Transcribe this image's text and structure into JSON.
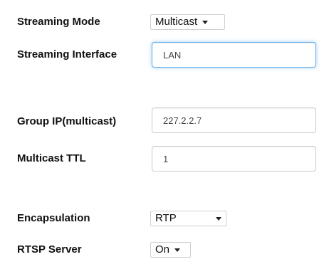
{
  "rows": {
    "streaming_mode": {
      "label": "Streaming Mode",
      "value": "Multicast"
    },
    "streaming_interface": {
      "label": "Streaming Interface",
      "value": "LAN"
    },
    "group_ip": {
      "label": "Group IP(multicast)",
      "value": "227.2.2.7"
    },
    "multicast_ttl": {
      "label": "Multicast TTL",
      "value": "1"
    },
    "encapsulation": {
      "label": "Encapsulation",
      "value": "RTP"
    },
    "rtsp_server": {
      "label": "RTSP Server",
      "value": "On"
    }
  },
  "icons": {
    "dropdown": "chevron-down-icon"
  },
  "colors": {
    "focus_border": "#66afe9",
    "input_border": "#cccccc"
  }
}
